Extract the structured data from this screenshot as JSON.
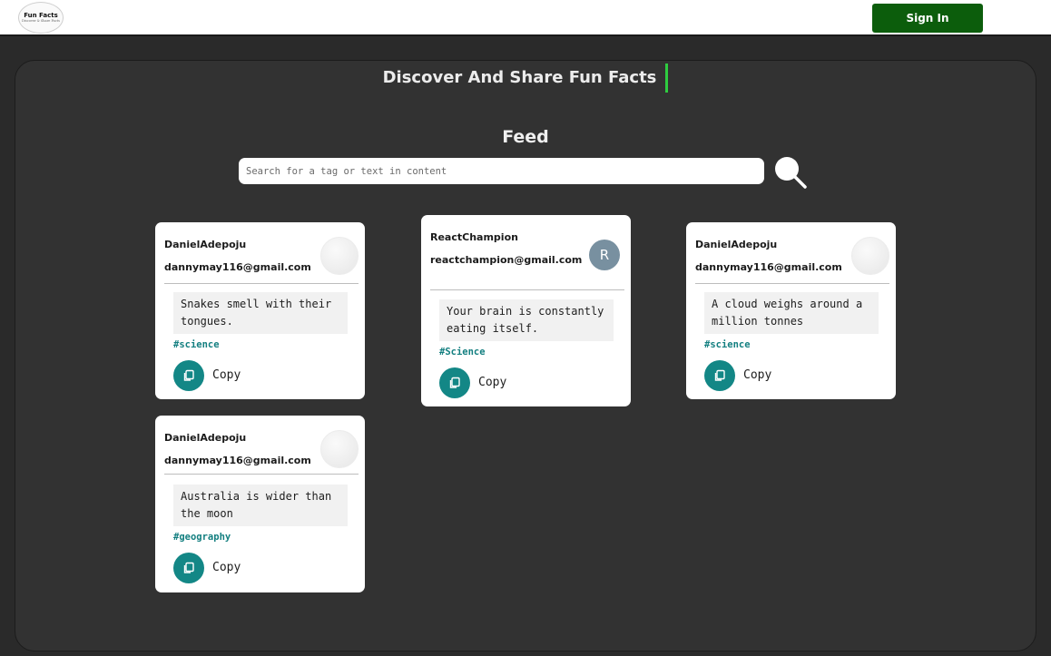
{
  "header": {
    "logo_title": "Fun Facts",
    "logo_subtitle": "Discover & Share Facts",
    "signin_label": "Sign In"
  },
  "hero": {
    "title": "Discover And Share Fun Facts"
  },
  "feed": {
    "title": "Feed",
    "search_placeholder": "Search for a tag or text in content"
  },
  "posts": [
    {
      "username": "DanielAdepoju",
      "email": "dannymay116@gmail.com",
      "content": "Snakes smell with their tongues.",
      "tag": "#science",
      "copy_label": "Copy"
    },
    {
      "username": "ReactChampion",
      "email": "reactchampion@gmail.com",
      "avatar_initial": "R",
      "content": "Your brain is constantly eating itself.",
      "tag": "#Science",
      "copy_label": "Copy"
    },
    {
      "username": "DanielAdepoju",
      "email": "dannymay116@gmail.com",
      "content": "A cloud weighs around a million tonnes",
      "tag": "#science",
      "copy_label": "Copy"
    },
    {
      "username": "DanielAdepoju",
      "email": "dannymay116@gmail.com",
      "content": "Australia is wider than the moon",
      "tag": "#geography",
      "copy_label": "Copy"
    }
  ],
  "colors": {
    "signin_bg": "#0c5d0c",
    "accent_teal": "#138786",
    "cursor_green": "#2ecc40",
    "panel_bg": "#323232"
  },
  "icons": {
    "search": "search-icon",
    "copy": "copy-icon"
  }
}
